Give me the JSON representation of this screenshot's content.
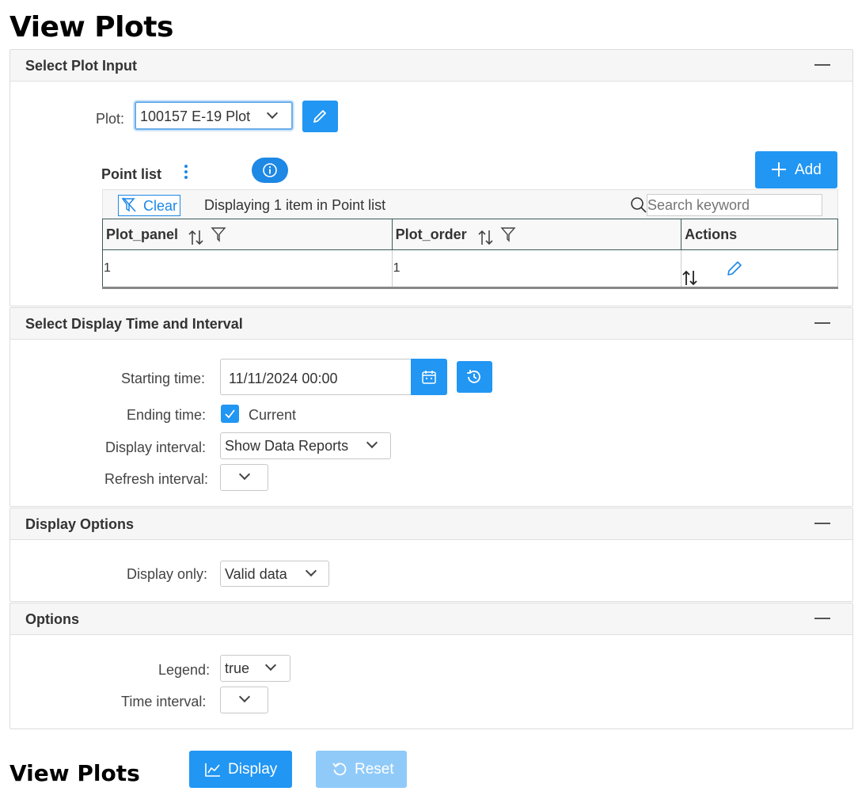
{
  "page": {
    "title": "View Plots"
  },
  "plot_input": {
    "header": "Select Plot Input",
    "plot_label": "Plot:",
    "plot_value": "100157 E-19 Plot",
    "point_list": {
      "title": "Point list",
      "add_label": "Add",
      "clear_label": "Clear",
      "status": "Displaying 1 item in Point list",
      "search_placeholder": "Search keyword",
      "columns": [
        "Plot_panel",
        "Plot_order",
        "Actions"
      ],
      "rows": [
        {
          "plot_panel": "1",
          "plot_order": "1"
        }
      ]
    }
  },
  "time_interval": {
    "header": "Select Display Time and Interval",
    "starting_label": "Starting time:",
    "starting_value": "11/11/2024 00:00",
    "ending_label": "Ending time:",
    "ending_current_label": "Current",
    "ending_current_checked": true,
    "display_interval_label": "Display interval:",
    "display_interval_value": "Show Data Reports",
    "refresh_interval_label": "Refresh interval:",
    "refresh_interval_value": ""
  },
  "display_options": {
    "header": "Display Options",
    "display_only_label": "Display only:",
    "display_only_value": "Valid data"
  },
  "options": {
    "header": "Options",
    "legend_label": "Legend:",
    "legend_value": "true",
    "time_interval_label": "Time interval:",
    "time_interval_value": ""
  },
  "footer": {
    "title": "View Plots",
    "display_label": "Display",
    "reset_label": "Reset"
  },
  "colors": {
    "accent": "#2196f3",
    "accent_disabled": "#90caf9"
  }
}
